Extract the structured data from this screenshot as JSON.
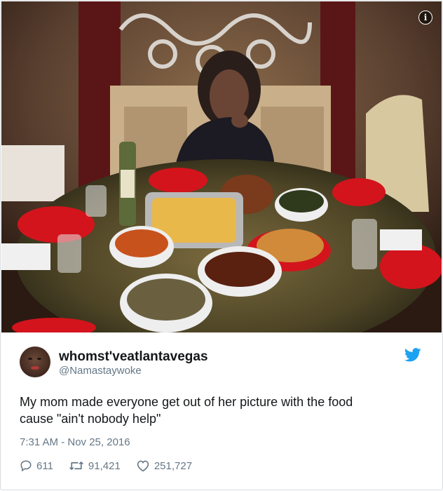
{
  "photo": {
    "alt_subject": "thanksgiving-dinner-photo"
  },
  "tweet": {
    "display_name": "whomst'veatlantavegas",
    "handle": "@Namastaywoke",
    "text_line1": "My mom made everyone get out of her picture with the food",
    "text_line2": "cause \"ain't nobody help\"",
    "timestamp": "7:31 AM - Nov 25, 2016",
    "replies": "611",
    "retweets": "91,421",
    "likes": "251,727"
  },
  "colors": {
    "twitter_blue": "#1da1f2",
    "muted_text": "#657786"
  },
  "icons": [
    "info-icon",
    "twitter-bird-icon",
    "reply-icon",
    "retweet-icon",
    "heart-icon"
  ]
}
